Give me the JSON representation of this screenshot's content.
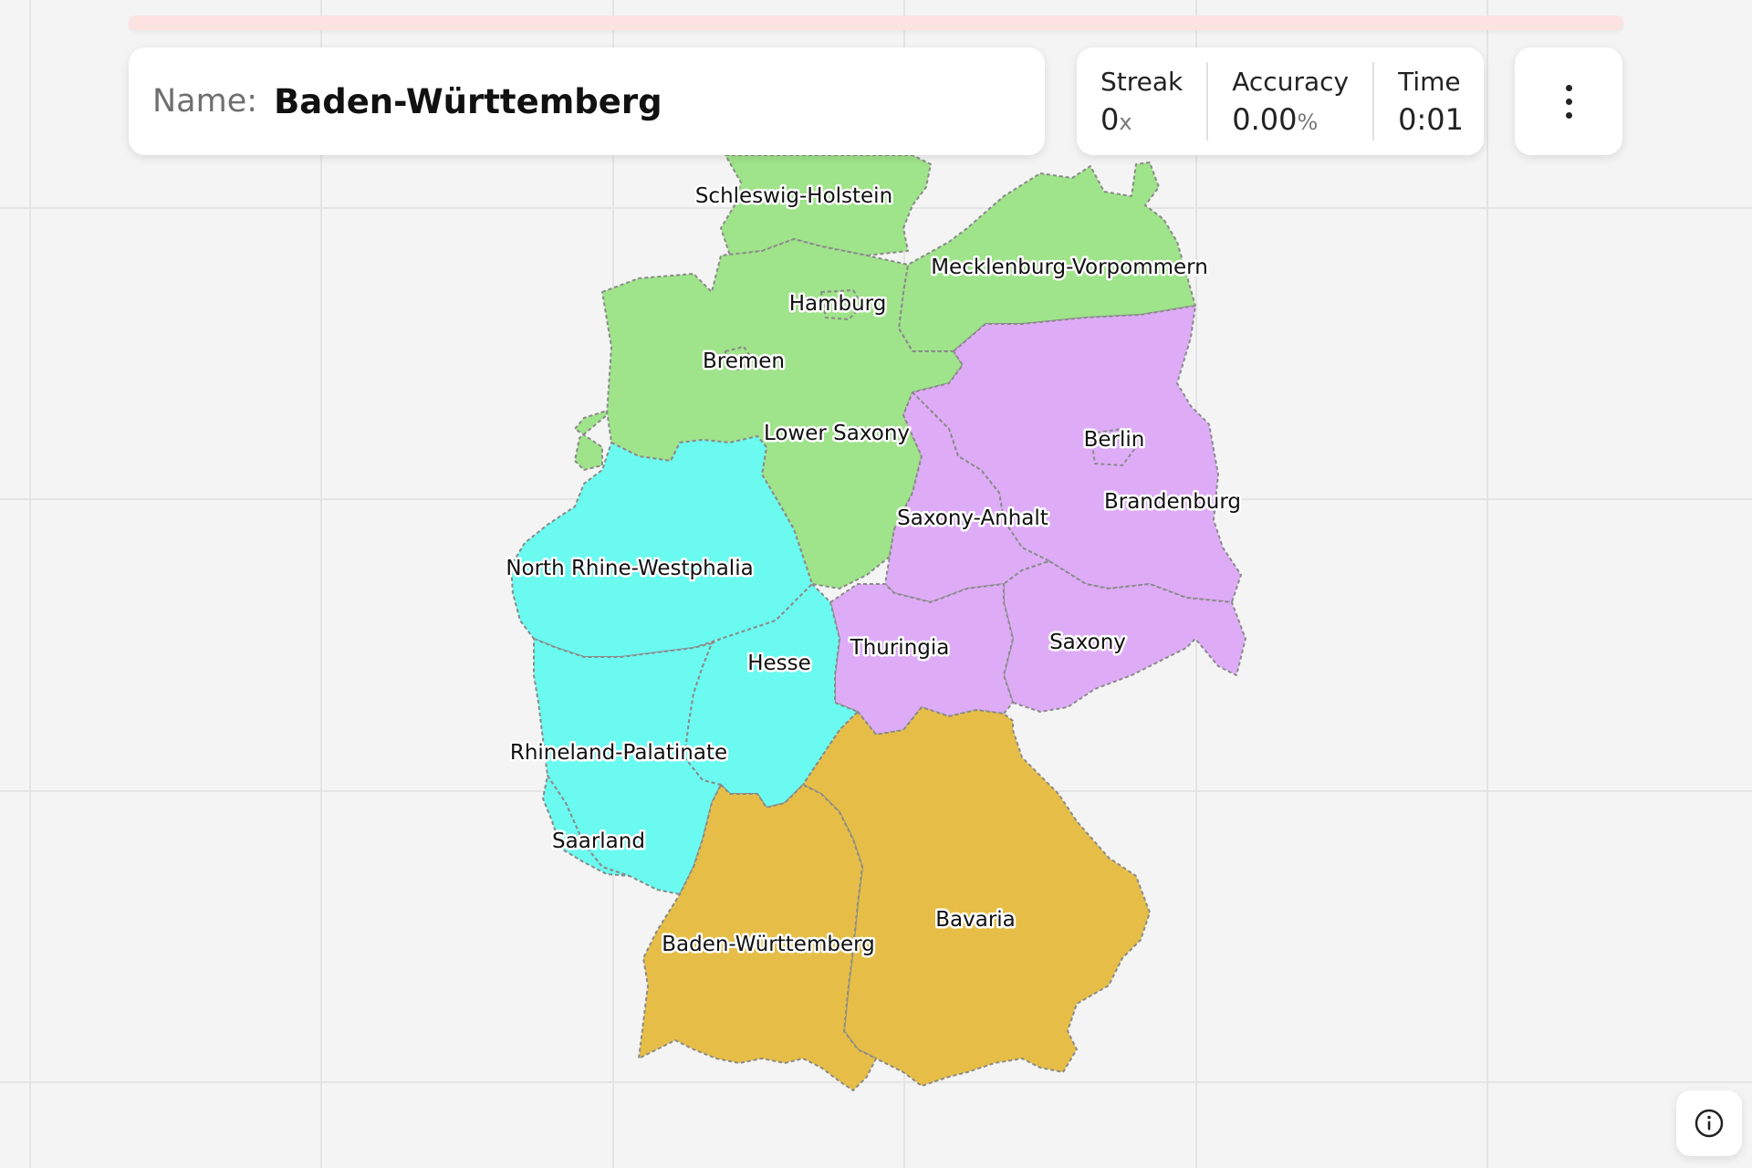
{
  "header": {
    "name_label": "Name:",
    "name_value": "Baden-Württemberg"
  },
  "stats": {
    "streak_label": "Streak",
    "streak_value": "0",
    "streak_unit": "x",
    "accuracy_label": "Accuracy",
    "accuracy_value": "0.00",
    "accuracy_unit": "%",
    "time_label": "Time",
    "time_value": "0:01"
  },
  "icons": {
    "menu": "more-vertical-icon",
    "info": "info-icon"
  },
  "colors": {
    "north": "#9fe38a",
    "west": "#6afaf0",
    "east": "#deacf7",
    "south": "#e6be47",
    "progress_track": "#fde2e2"
  },
  "progress_fraction": 0,
  "map": {
    "states": [
      "Schleswig-Holstein",
      "Mecklenburg-Vorpommern",
      "Hamburg",
      "Bremen",
      "Lower Saxony",
      "Berlin",
      "Brandenburg",
      "Saxony-Anhalt",
      "North Rhine-Westphalia",
      "Hesse",
      "Thuringia",
      "Saxony",
      "Rhineland-Palatinate",
      "Saarland",
      "Bavaria",
      "Baden-Württemberg"
    ]
  }
}
